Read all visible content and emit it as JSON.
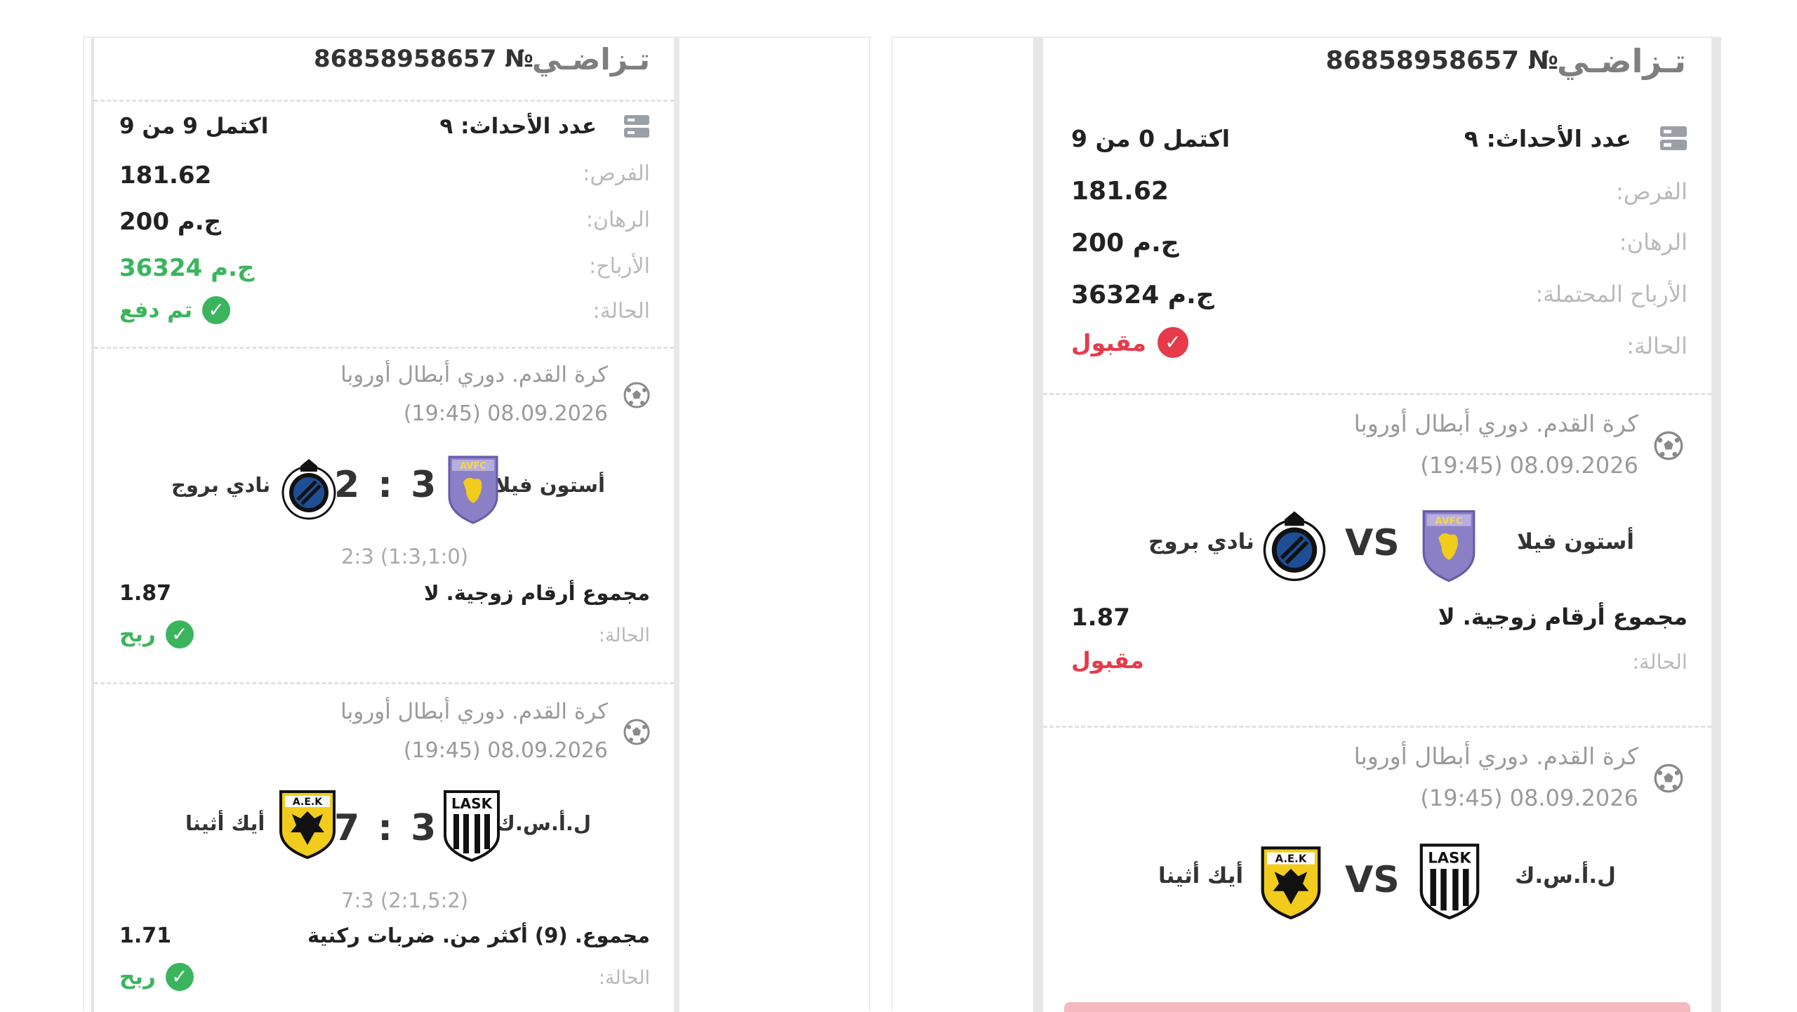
{
  "left": {
    "ticket_word": "تـزاضـي",
    "ticket_number": "86858958657 №",
    "summary": {
      "events_count": "عدد الأحداث: ٩",
      "completed": "اكتمل 9 من 9",
      "odds_label": "الفرص:",
      "odds_value": "181.62",
      "stake_label": "الرهان:",
      "stake_value": "200 ج.م",
      "winnings_label": "الأرباح:",
      "winnings_value": "36324 ج.م",
      "status_label": "الحالة:",
      "status_value": "تم دفع"
    },
    "events": [
      {
        "league": "كرة القدم. دوري أبطال أوروبا",
        "datetime": "(19:45) 08.09.2026",
        "home_team": "أستون فيلا",
        "away_team": "نادي بروج",
        "home_crest": "AVFC",
        "away_crest": "club-brugge-crest",
        "score": "2 : 3",
        "detail": "2:3 (1:3,1:0)",
        "market": "مجموع أرقام زوجية. لا",
        "odd": "1.87",
        "status_label": "الحالة:",
        "status_value": "ربح"
      },
      {
        "league": "كرة القدم. دوري أبطال أوروبا",
        "datetime": "(19:45) 08.09.2026",
        "home_team": "ل.أ.س.ك",
        "away_team": "أيك أثينا",
        "home_crest": "LASK",
        "away_crest": "AEK",
        "score": "7 : 3",
        "detail": "7:3 (2:1,5:2)",
        "market": "مجموع. (9) أكثر من. ضربات ركنية",
        "odd": "1.71",
        "status_label": "الحالة:",
        "status_value": "ربح"
      }
    ]
  },
  "right": {
    "ticket_word": "تـزاضـي",
    "ticket_number": "86858958657 №",
    "summary": {
      "events_count": "عدد الأحداث: ٩",
      "completed": "اكتمل 0 من 9",
      "odds_label": "الفرص:",
      "odds_value": "181.62",
      "stake_label": "الرهان:",
      "stake_value": "200 ج.م",
      "winnings_label": "الأرباح المحتملة:",
      "winnings_value": "36324 ج.م",
      "status_label": "الحالة:",
      "status_value": "مقبول"
    },
    "events": [
      {
        "league": "كرة القدم. دوري أبطال أوروبا",
        "datetime": "(19:45) 08.09.2026",
        "home_team": "أستون فيلا",
        "away_team": "نادي بروج",
        "home_crest": "AVFC",
        "away_crest": "club-brugge-crest",
        "vs": "VS",
        "market": "مجموع أرقام زوجية. لا",
        "odd": "1.87",
        "status_label": "الحالة:",
        "status_value": "مقبول"
      },
      {
        "league": "كرة القدم. دوري أبطال أوروبا",
        "datetime": "(19:45) 08.09.2026",
        "home_team": "ل.أ.س.ك",
        "away_team": "أيك أثينا",
        "home_crest": "LASK",
        "away_crest": "AEK",
        "vs": "VS"
      }
    ]
  },
  "colors": {
    "win_green": "#3ab55d",
    "accepted_red": "#e53b4a",
    "aston_villa": "#7f6fb9",
    "brugge_blue": "#1e4f96",
    "aek_yellow": "#f2cc1c"
  },
  "icons": [
    "list-icon",
    "soccer-ball-icon",
    "check-circle-icon"
  ]
}
